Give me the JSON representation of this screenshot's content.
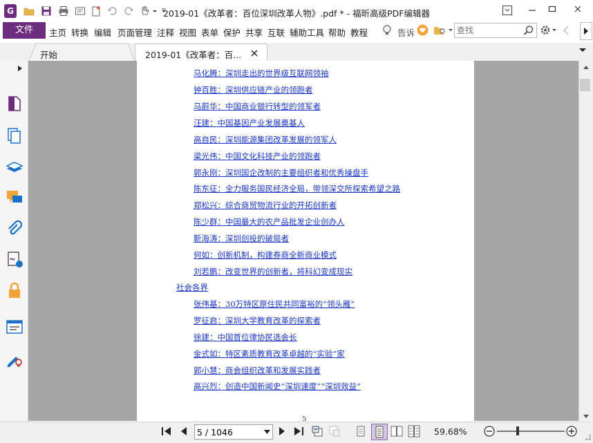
{
  "app": {
    "window_title": "2019-01《改革者：百位深圳改革人物》.pdf * - 福昕高级PDF编辑器",
    "logo_letter": "G"
  },
  "menu": {
    "file": "文件",
    "items": [
      "主页",
      "转换",
      "编辑",
      "页面管理",
      "注释",
      "视图",
      "表单",
      "保护",
      "共享",
      "互联",
      "辅助工具",
      "帮助",
      "教程"
    ],
    "tell_me": "告诉",
    "search_placeholder": "查找"
  },
  "tabs": [
    {
      "label": "开始"
    },
    {
      "label": "2019-01《改革者：百..."
    }
  ],
  "document": {
    "toc": [
      {
        "text": "马化腾：深圳走出的世界级互联网领袖",
        "type": "entry"
      },
      {
        "text": "钟百胜：深圳供应链产业的领跑者",
        "type": "entry"
      },
      {
        "text": "马蔚华：中国商业银行转型的领军者",
        "type": "entry"
      },
      {
        "text": "汪建：中国基因产业发展奠基人",
        "type": "entry"
      },
      {
        "text": "高自民：深圳能源集团改革发展的领军人",
        "type": "entry"
      },
      {
        "text": "梁光伟：中国文化科技产业的领跑者",
        "type": "entry"
      },
      {
        "text": "郭永刚：深圳国企改制的主要组织者和优秀操盘手",
        "type": "entry"
      },
      {
        "text": "陈东征：全力服务国民经济全局，带领深交所探索希望之路",
        "type": "entry"
      },
      {
        "text": "郑松兴：综合商贸物流行业的开拓创新者",
        "type": "entry"
      },
      {
        "text": "陈少群：中国最大的农产品批发企业创办人",
        "type": "entry"
      },
      {
        "text": "靳海涛：深圳创投的破局者",
        "type": "entry"
      },
      {
        "text": "何如：创新机制，构建券商全新商业模式",
        "type": "entry"
      },
      {
        "text": "刘若鹏：改变世界的创新者，将科幻变成现实",
        "type": "entry"
      },
      {
        "text": "社会各界",
        "type": "category"
      },
      {
        "text": "张伟基：30万特区原住民共同富裕的“领头雁”",
        "type": "entry"
      },
      {
        "text": "罗征启：深圳大学教育改革的探索者",
        "type": "entry"
      },
      {
        "text": "徐建：中国首位律协民选会长",
        "type": "entry"
      },
      {
        "text": "金式如：特区素质教育改革卓越的“实验”家",
        "type": "entry"
      },
      {
        "text": "郭小慧：商会组织改革和发展实践者",
        "type": "entry"
      },
      {
        "text": "高兴烈：创造中国新闻史“深圳速度”“深圳效益”",
        "type": "entry"
      }
    ],
    "page_number_printed": "5"
  },
  "status": {
    "page_field": "5 / 1046",
    "zoom": "59.68%"
  },
  "colors": {
    "brand": "#6d2d7e",
    "link": "#1a36c7",
    "canvas": "#a6a6a6"
  }
}
